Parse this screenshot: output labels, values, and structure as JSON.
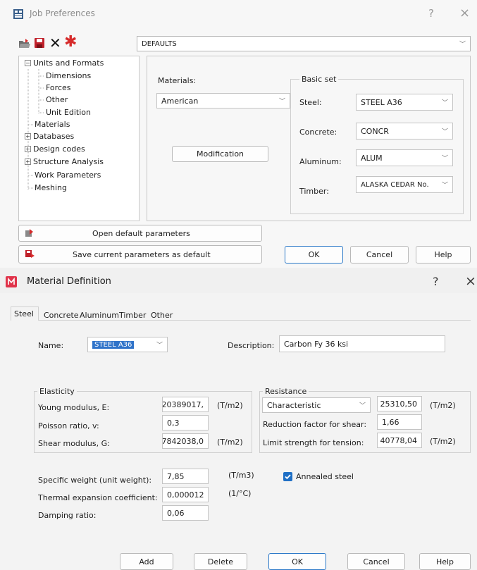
{
  "job_prefs": {
    "title": "Job Preferences",
    "help_btn": "?",
    "close_btn": "×",
    "preset_value": "DEFAULTS",
    "tree": {
      "units_and_formats": "Units and Formats",
      "dimensions": "Dimensions",
      "forces": "Forces",
      "other": "Other",
      "unit_edition": "Unit Edition",
      "materials": "Materials",
      "databases": "Databases",
      "design_codes": "Design codes",
      "structure_analysis": "Structure Analysis",
      "work_parameters": "Work Parameters",
      "meshing": "Meshing"
    },
    "materials_label": "Materials:",
    "materials_value": "American",
    "modification_button": "Modification",
    "basic_set_title": "Basic set",
    "steel_label": "Steel:",
    "steel_value": "STEEL A36",
    "concrete_label": "Concrete:",
    "concrete_value": "CONCR",
    "aluminum_label": "Aluminum:",
    "aluminum_value": "ALUM",
    "timber_label": "Timber:",
    "timber_value": "ALASKA CEDAR No.",
    "open_default_button": "Open default parameters",
    "save_default_button": "Save current parameters as default",
    "ok_button": "OK",
    "cancel_button": "Cancel",
    "help_button": "Help"
  },
  "material_def": {
    "title": "Material Definition",
    "help_btn": "?",
    "close_btn": "×",
    "tabs": [
      "Steel",
      "Concrete",
      "Aluminum",
      "Timber",
      "Other"
    ],
    "name_label": "Name:",
    "name_value": "STEEL A36",
    "description_label": "Description:",
    "description_value": "Carbon Fy 36 ksi",
    "elasticity_title": "Elasticity",
    "young_label": "Young modulus, E:",
    "young_value": "20389017,",
    "young_unit": "(T/m2)",
    "poisson_label": "Poisson ratio, v:",
    "poisson_value": "0,3",
    "shear_label": "Shear modulus, G:",
    "shear_value": "7842038,0",
    "shear_unit": "(T/m2)",
    "resistance_title": "Resistance",
    "characteristic_value": "Characteristic",
    "resistance_value": "25310,50",
    "resistance_unit": "(T/m2)",
    "reduction_label": "Reduction factor for shear:",
    "reduction_value": "1,66",
    "limit_label": "Limit strength for tension:",
    "limit_value": "40778,04",
    "limit_unit": "(T/m2)",
    "specific_weight_label": "Specific weight (unit weight):",
    "specific_weight_value": "7,85",
    "specific_weight_unit": "(T/m3)",
    "thermal_label": "Thermal expansion coefficient:",
    "thermal_value": "0,000012",
    "thermal_unit": "(1/°C)",
    "damping_label": "Damping ratio:",
    "damping_value": "0,06",
    "annealed_label": "Annealed steel",
    "annealed_checked": true,
    "add_button": "Add",
    "delete_button": "Delete",
    "ok_button": "OK",
    "cancel_button": "Cancel",
    "help_button": "Help"
  },
  "colors": {
    "accent": "#2a78c8",
    "check": "#1f6fc5",
    "icon_red": "#d62b2b"
  }
}
